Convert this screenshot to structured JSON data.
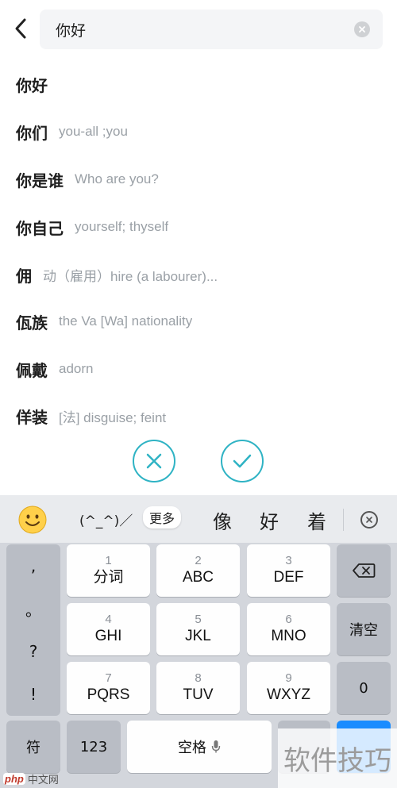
{
  "search": {
    "query": "你好"
  },
  "results": [
    {
      "word": "你好",
      "definition": ""
    },
    {
      "word": "你们",
      "definition": "you-all ;you"
    },
    {
      "word": "你是谁",
      "definition": "Who are you?"
    },
    {
      "word": "你自己",
      "definition": "yourself; thyself"
    },
    {
      "word": "佣",
      "definition": "动（雇用）hire (a labourer)..."
    },
    {
      "word": "佤族",
      "definition": "the Va [Wa] nationality"
    },
    {
      "word": "佩戴",
      "definition": "adorn"
    },
    {
      "word": "佯装",
      "definition": "[法] disguise; feint"
    }
  ],
  "candidate_bar": {
    "kaomoji": "(^_^)／",
    "more": "更多",
    "candidates": [
      "像",
      "好",
      "着"
    ]
  },
  "keyboard": {
    "punct": [
      ",",
      "。",
      "?",
      "!"
    ],
    "keys": [
      {
        "num": "1",
        "letters": "分词"
      },
      {
        "num": "2",
        "letters": "ABC"
      },
      {
        "num": "3",
        "letters": "DEF"
      },
      {
        "num": "4",
        "letters": "GHI"
      },
      {
        "num": "5",
        "letters": "JKL"
      },
      {
        "num": "6",
        "letters": "MNO"
      },
      {
        "num": "7",
        "letters": "PQRS"
      },
      {
        "num": "8",
        "letters": "TUV"
      },
      {
        "num": "9",
        "letters": "WXYZ"
      }
    ],
    "clear": "清空",
    "zero": "0",
    "symbol": "符",
    "numeric": "123",
    "space": "空格"
  },
  "watermark": {
    "text": "软件技巧",
    "site_badge": "php",
    "site_text": "中文网"
  },
  "colors": {
    "accent": "#2fb3c4",
    "keyboard_bg": "#d3d6dc",
    "key_dark": "#b9bdc5"
  }
}
